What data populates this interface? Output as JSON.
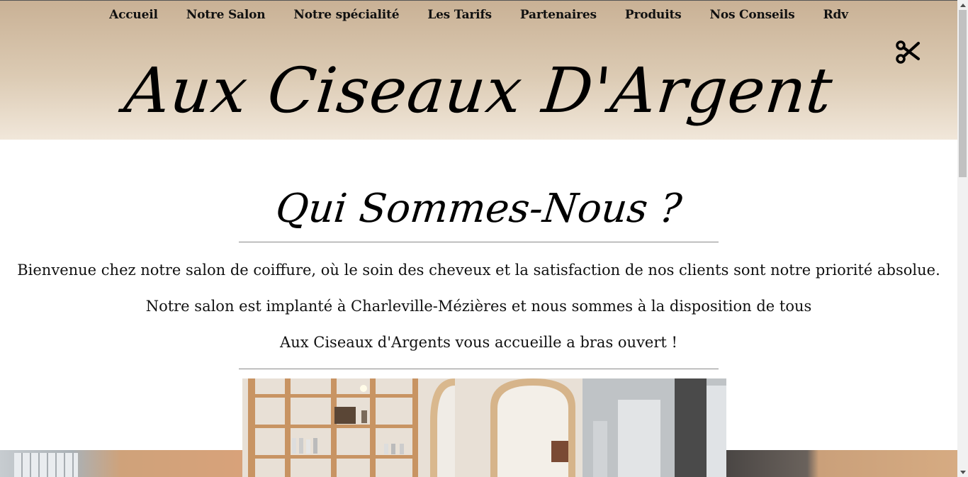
{
  "nav": {
    "items": [
      {
        "label": "Accueil"
      },
      {
        "label": "Notre Salon"
      },
      {
        "label": "Notre spécialité"
      },
      {
        "label": "Les Tarifs"
      },
      {
        "label": "Partenaires"
      },
      {
        "label": "Produits"
      },
      {
        "label": "Nos Conseils"
      },
      {
        "label": "Rdv"
      }
    ]
  },
  "header": {
    "site_title": "Aux Ciseaux D'Argent",
    "icon": "scissors-icon"
  },
  "about": {
    "title": "Qui Sommes-Nous ?",
    "paragraphs": [
      "Bienvenue chez notre salon de coiffure, où le soin des cheveux et la satisfaction de nos clients sont notre priorité absolue.",
      "Notre salon est implanté à Charleville-Mézières et nous sommes à la disposition de tous",
      "Aux Ciseaux d'Argents vous accueille a bras ouvert !"
    ]
  },
  "colors": {
    "header_top": "#c9b195",
    "header_bottom": "#f1e7da",
    "text": "#000000",
    "rule": "#8a8a8a"
  }
}
